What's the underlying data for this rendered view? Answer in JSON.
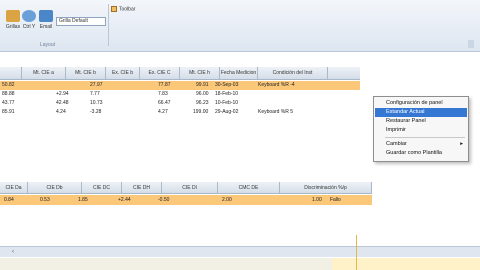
{
  "ribbon": {
    "buttons": [
      {
        "label": "Grillas",
        "icon": "grid-icon",
        "color": "#d9a441"
      },
      {
        "label": "Ctrl Y",
        "icon": "refresh-icon",
        "color": "#6aa0d8"
      },
      {
        "label": "Email",
        "icon": "email-icon",
        "color": "#4a86c8"
      }
    ],
    "combo_value": "Grilla Default",
    "toolbar_label": "Toolbar",
    "group_label": "Layout"
  },
  "grid1": {
    "columns": [
      "Mt. CIE a",
      "Mt. CIE b",
      "Ex. CIE b",
      "Ex. CIE C",
      "Mt. CIE h",
      "Fecha Medicion",
      "Condición del Inst"
    ],
    "rows": [
      {
        "c1": "",
        "c2": "",
        "c3": "27.97",
        "c4": "77.87",
        "c5": "99.91",
        "date": "30-Sep-03",
        "cond": "Keyboard %R -4"
      },
      {
        "c1": "",
        "c2": "+2.94",
        "c3": "7.77",
        "c4": "7.83",
        "c5": "96.00",
        "date": "18-Feb-10",
        "cond": ""
      },
      {
        "c1": "",
        "c2": "42.48",
        "c3": "10.73",
        "c4": "66.47",
        "c5": "96.23",
        "date": "10-Feb-10",
        "cond": ""
      },
      {
        "c1": "",
        "c2": "4.24",
        "c3": "-3.28",
        "c4": "4.27",
        "c5": "199.00",
        "date": "29-Aug-02",
        "cond": "Keyboard %R 5"
      }
    ],
    "left_values": [
      "50.82",
      "88.88",
      "43.77",
      "85.91"
    ]
  },
  "context_menu": {
    "items": [
      {
        "label": "Configuración de panel"
      },
      {
        "label": "Estandar Actual"
      },
      {
        "label": "Restaurar Panel"
      },
      {
        "label": "Imprimir"
      },
      {
        "label": "Cambiar"
      },
      {
        "label": "Guardar como Plantilla"
      }
    ],
    "submenu_arrow": "▸"
  },
  "grid2": {
    "columns": [
      "CIE Da",
      "CIE Db",
      "CIE DC",
      "CIE DH",
      "CIE Dl",
      "CMC DE",
      "Discriminación %/p"
    ],
    "row": {
      "c1": "0.84",
      "c2": "0.53",
      "c3": "1.85",
      "c4": "+2.44",
      "c5": "-0.50",
      "c6": "2.00",
      "c7": "1.00",
      "status": "Fallo"
    }
  },
  "bottom": {
    "tab_glyph": "‹"
  },
  "colors": {
    "selected_row": "#fbc779",
    "menu_highlight": "#3478d4"
  }
}
